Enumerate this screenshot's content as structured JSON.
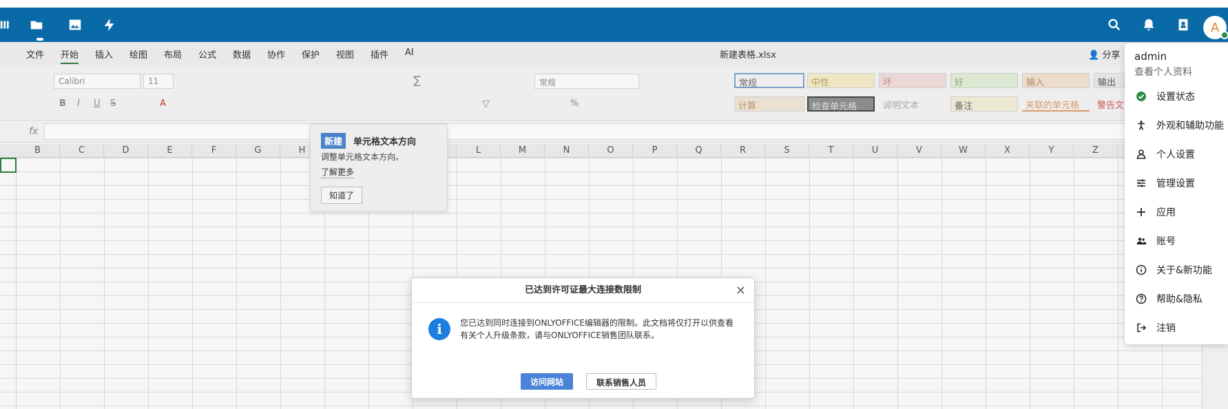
{
  "menubar": {
    "items": [
      "文件",
      "开始",
      "插入",
      "绘图",
      "布局",
      "公式",
      "数据",
      "协作",
      "保护",
      "视图",
      "插件",
      "AI"
    ],
    "active_index": 1,
    "doc_title": "新建表格.xlsx",
    "share_label": "分享"
  },
  "toolbar": {
    "font_name": "Calibri",
    "font_size": "11",
    "number_format": "常规",
    "styles_row1": [
      "常规",
      "中性",
      "坏",
      "好",
      "输入",
      "输出"
    ],
    "styles_row2": [
      "计算",
      "检查单元格",
      "说明文本",
      "备注",
      "关联的单元格",
      "警告文"
    ]
  },
  "columns": [
    "B",
    "C",
    "D",
    "E",
    "F",
    "G",
    "H",
    "",
    "",
    "",
    "L",
    "M",
    "N",
    "O",
    "P",
    "Q",
    "R",
    "S",
    "T",
    "U",
    "V",
    "W",
    "X",
    "Y",
    "Z"
  ],
  "tip": {
    "badge": "新建",
    "title": "单元格文本方向",
    "desc": "调整单元格文本方向。",
    "more": "了解更多",
    "ok": "知道了"
  },
  "modal": {
    "title": "已达到许可证最大连接数限制",
    "line1": "您已达到同时连接到ONLYOFFICE编辑器的限制。此文档将仅打开以供查看",
    "line2": "有关个人升级条款，请与ONLYOFFICE销售团队联系。",
    "visit": "访问网站",
    "contact": "联系销售人员"
  },
  "usermenu": {
    "username": "admin",
    "profile": "查看个人资料",
    "items": [
      {
        "label": "设置状态",
        "icon": "check-circle-icon"
      },
      {
        "label": "外观和辅助功能",
        "icon": "accessibility-icon"
      },
      {
        "label": "个人设置",
        "icon": "person-icon"
      },
      {
        "label": "管理设置",
        "icon": "sliders-icon"
      },
      {
        "label": "应用",
        "icon": "plus-icon"
      },
      {
        "label": "账号",
        "icon": "users-icon"
      },
      {
        "label": "关于&新功能",
        "icon": "info-icon"
      },
      {
        "label": "帮助&隐私",
        "icon": "help-icon"
      },
      {
        "label": "注销",
        "icon": "logout-icon"
      }
    ]
  },
  "avatar": {
    "initial": "A"
  },
  "colors": {
    "topbar": "#0a6aa7",
    "accent_green": "#2d7a3a",
    "primary_button": "#4a83d8"
  }
}
